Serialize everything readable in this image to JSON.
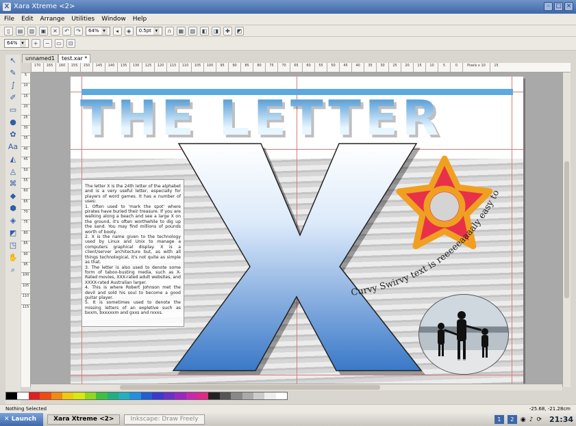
{
  "window": {
    "title": "Xara Xtreme <2>"
  },
  "menu": [
    "File",
    "Edit",
    "Arrange",
    "Utilities",
    "Window",
    "Help"
  ],
  "toolbar": {
    "zoom1": "64%",
    "zoom2": "64%",
    "line_width": "0.5pt"
  },
  "tabs": [
    "unnamed1",
    "test.xar *"
  ],
  "ruler_h": [
    "170",
    "165",
    "160",
    "155",
    "150",
    "145",
    "140",
    "135",
    "130",
    "125",
    "120",
    "115",
    "110",
    "105",
    "100",
    "95",
    "90",
    "85",
    "80",
    "75",
    "70",
    "65",
    "60",
    "55",
    "50",
    "45",
    "40",
    "35",
    "30",
    "25",
    "20",
    "15",
    "10",
    "5",
    "0",
    "Pixels x 10",
    "15"
  ],
  "ruler_v": [
    "5",
    "10",
    "15",
    "20",
    "25",
    "30",
    "35",
    "40",
    "45",
    "50",
    "55",
    "60",
    "65",
    "70",
    "75",
    "80",
    "85",
    "90",
    "95",
    "100",
    "105",
    "110",
    "115"
  ],
  "document": {
    "title": "THE LETTER",
    "big_letter": "X",
    "curvy_text": "Curvy Swirvy text is reeeeeaaaaly easy to do!",
    "body_text": "The letter X is the 24th letter of the alphabet and is a very useful letter, especially for players of word games. It has a number of uses:\n1. Often used to 'mark the spot' where pirates have buried their treasure. If you are walking along a beach and see a large X on the ground, it's often worthwhile to dig up the sand. You may find millions of pounds worth of booty.\n2. X is the name given to the technology used by Linux and Unix to manage a computers graphical display. X is a client/server architecture but, as with all things technological, it's not quite as simple as that.\n3. The letter is also used to denote some form of taboo-busting media, such as X-Rated movies, XXX-rated adult websites, and XXXX-rated Australian larger.\n4. This is where Robert Johnson met the devil and sold his soul to become a good guitar player.\n5. It is sometimes used to denote the missing letters of an expletive such as bxxm, bxxxxxm and gxxs and rxxxs."
  },
  "palette": [
    "#000000",
    "#ffffff",
    "#e02020",
    "#f04a10",
    "#f08a10",
    "#f0c810",
    "#d8e810",
    "#90d820",
    "#40c040",
    "#20b080",
    "#20b0c0",
    "#2090e0",
    "#2060d0",
    "#3a3ad0",
    "#6a30c8",
    "#9a28c0",
    "#c828b0",
    "#e02888",
    "#222222",
    "#555555",
    "#888888",
    "#aaaaaa",
    "#cccccc",
    "#eeeeee",
    "#ffffff"
  ],
  "status": {
    "message": "Nothing Selected",
    "coords": "-25.68, -21.28cm"
  },
  "taskbar": {
    "launch": "Launch",
    "tasks": [
      "Xara Xtreme <2>",
      "Inkscape: Draw Freely"
    ],
    "desktops": [
      "1",
      "2"
    ],
    "clock": "21:34"
  },
  "colors": {
    "accent": "#3e67a8",
    "star_fill": "#e8304a",
    "star_outline": "#f0a020",
    "x_top": "#ffffff",
    "x_bottom": "#3a78c8"
  }
}
